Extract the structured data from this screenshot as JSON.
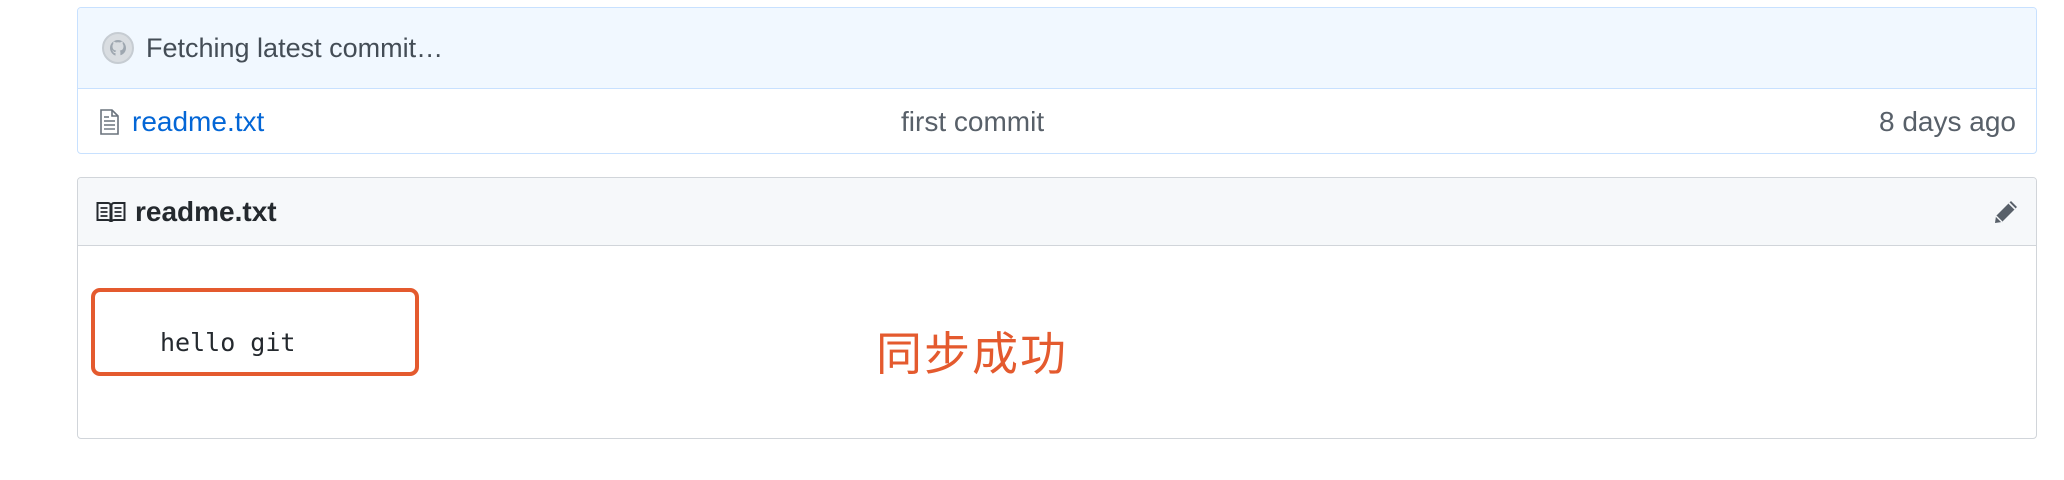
{
  "commit_tease": {
    "text": "Fetching latest commit…",
    "avatar_icon": "github-octocat-icon"
  },
  "files": [
    {
      "icon": "file-text-icon",
      "name": "readme.txt",
      "message": "first commit",
      "age": "8 days ago"
    }
  ],
  "readme": {
    "icon": "book-icon",
    "title": "readme.txt",
    "edit_icon": "pencil-icon",
    "content": "hello git"
  },
  "annotation": {
    "text": "同步成功",
    "color": "#e45a2e"
  },
  "colors": {
    "link": "#0366d6",
    "tease_background": "#f1f8ff",
    "header_background": "#f6f8fa"
  }
}
